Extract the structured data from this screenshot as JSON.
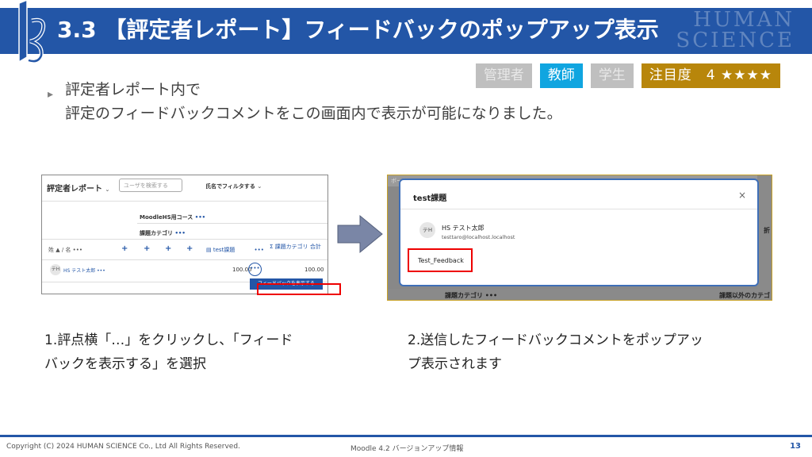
{
  "header": {
    "title": "3.3 【評定者レポート】フィードバックのポップアップ表示",
    "watermark_line1": "HUMAN",
    "watermark_line2": "SCIENCE",
    "accent_color": "#2356a7"
  },
  "badges": [
    {
      "label": "管理者",
      "active": false
    },
    {
      "label": "教師",
      "active": true
    },
    {
      "label": "学生",
      "active": false
    },
    {
      "label": "注目度　4 ★★★★",
      "active": true
    }
  ],
  "bullet": {
    "line1": "評定者レポート内で",
    "line2": "評定のフィードバックコメントをこの画面内で表示が可能になりました。"
  },
  "screenshot1": {
    "title": "評定者レポート",
    "search_placeholder": "ユーザを検索する",
    "filter_label": "氏名でフィルタする",
    "course_label": "MoodleHS用コース",
    "category_label": "課題カテゴリ",
    "name_header": "姓 ▲ / 名",
    "assignment_label": "test課題",
    "total_label": "課題カテゴリ 合計",
    "avatar_initials": "テH",
    "user_name": "HS テスト太郎",
    "grade_value": "100.00",
    "total_value": "100.00",
    "tooltip": "フィードバックを表示する"
  },
  "screenshot2": {
    "bg_top": "ボード",
    "bg_bottom": "課題カテゴリ",
    "bg_bottom_right": "課題以外のカテゴ",
    "bg_right_text": "折",
    "modal_title": "test課題",
    "avatar_initials": "テH",
    "user_name": "HS テスト太郎",
    "user_email": "testtaro@localhost.localhost",
    "feedback": "Test_Feedback"
  },
  "captions": {
    "step1_line1": "1.評点横「…」をクリックし、「フィード",
    "step1_line2": "バックを表示する」を選択",
    "step2_line1": "2.送信したフィードバックコメントをポップアッ",
    "step2_line2": "プ表示されます"
  },
  "footer": {
    "copyright": "Copyright (C) 2024 HUMAN SCIENCE Co., Ltd All Rights Reserved.",
    "center": "Moodle 4.2 バージョンアップ情報",
    "page": "13"
  }
}
